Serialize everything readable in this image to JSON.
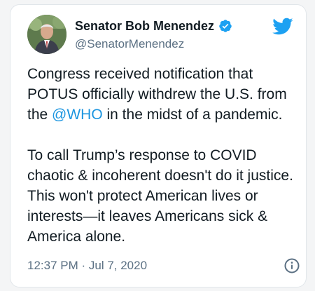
{
  "tweet": {
    "author": {
      "display_name": "Senator Bob Menendez",
      "handle": "@SenatorMenendez",
      "verified_icon": "verified-badge-icon",
      "avatar": "avatar-photo"
    },
    "brand_icon": "twitter-bird-icon",
    "text_part1_a": "Congress received notification that POTUS officially withdrew the U.S. from the ",
    "mention": "@WHO",
    "text_part1_b": " in the midst of a pandemic.",
    "text_part2": "To call Trump’s response to COVID chaotic & incoherent doesn't do it justice. This won't protect American lives or interests—it leaves Americans sick & America alone.",
    "timestamp": "12:37 PM · Jul 7, 2020",
    "info_icon": "info-icon"
  },
  "colors": {
    "accent": "#1b95e0",
    "text": "#111b22",
    "secondary_text": "#5b7083",
    "verified": "#1da1f2"
  }
}
